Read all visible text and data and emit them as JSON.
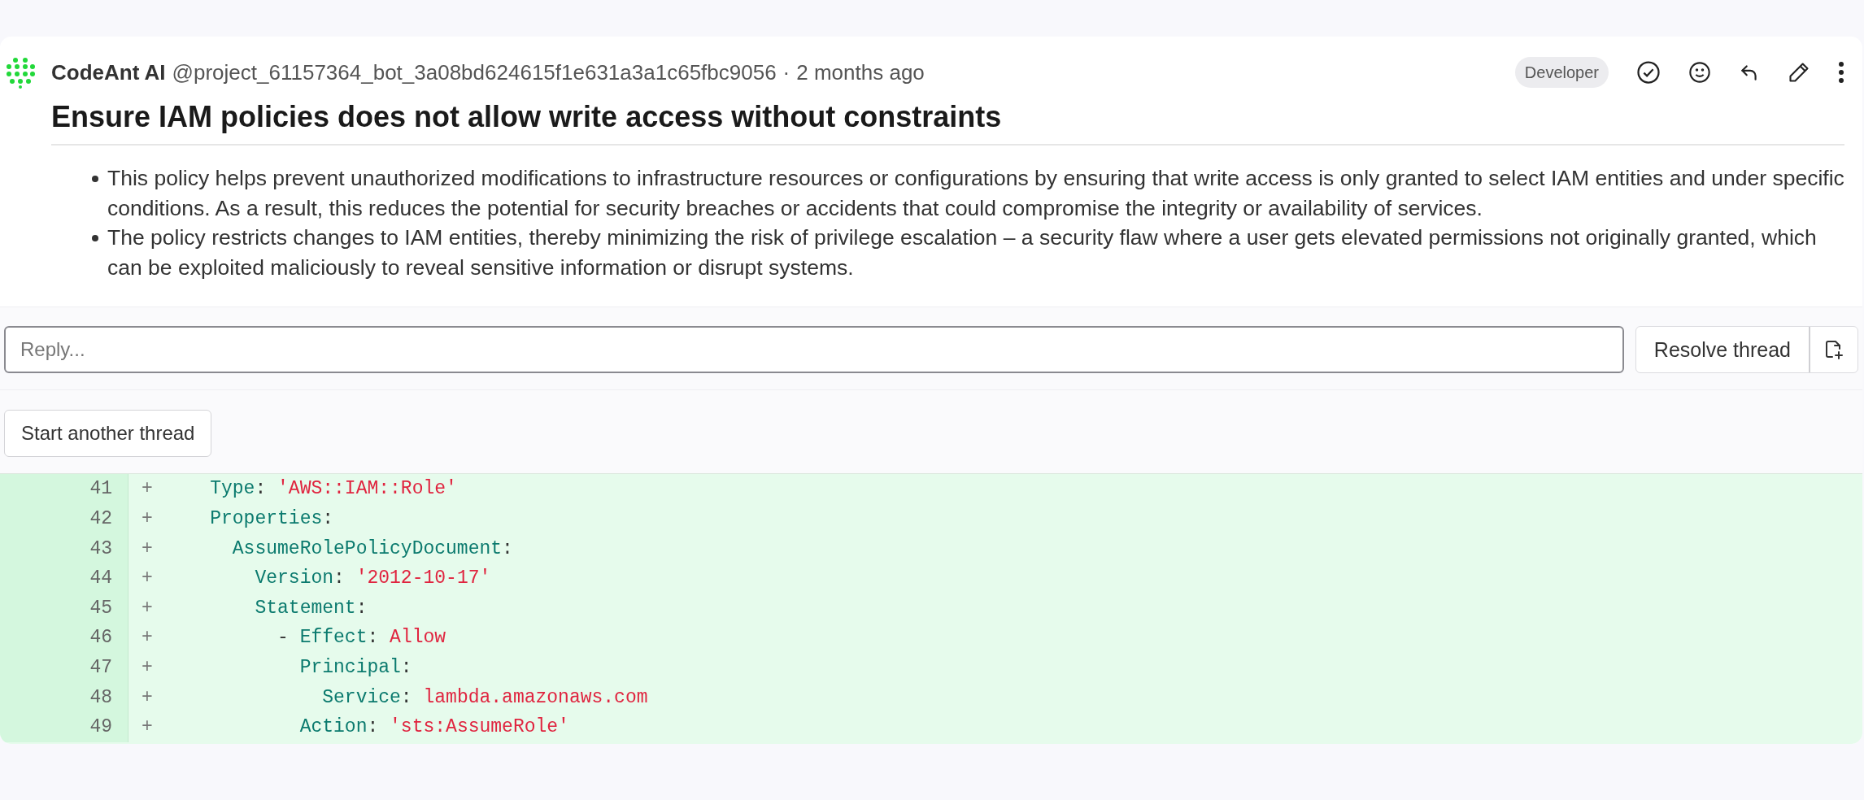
{
  "comment": {
    "author": "CodeAnt AI",
    "handle": "@project_61157364_bot_3a08bd624615f1e631a3a1c65fbc9056",
    "separator": "·",
    "time": "2 months ago",
    "role": "Developer",
    "title": "Ensure IAM policies does not allow write access without constraints",
    "bullets": [
      "This policy helps prevent unauthorized modifications to infrastructure resources or configurations by ensuring that write access is only granted to select IAM entities and under specific conditions. As a result, this reduces the potential for security breaches or accidents that could compromise the integrity or availability of services.",
      "The policy restricts changes to IAM entities, thereby minimizing the risk of privilege escalation – a security flaw where a user gets elevated permissions not originally granted, which can be exploited maliciously to reveal sensitive information or disrupt systems."
    ]
  },
  "reply": {
    "placeholder": "Reply...",
    "resolve_button": "Resolve thread"
  },
  "start_thread_button": "Start another thread",
  "diff": [
    {
      "number": "41",
      "sign": "+",
      "tokens": [
        {
          "kind": "key",
          "text": "    Type"
        },
        {
          "kind": "punct",
          "text": ": "
        },
        {
          "kind": "string",
          "text": "'AWS::IAM::Role'"
        }
      ]
    },
    {
      "number": "42",
      "sign": "+",
      "tokens": [
        {
          "kind": "key",
          "text": "    Properties"
        },
        {
          "kind": "punct",
          "text": ":"
        }
      ]
    },
    {
      "number": "43",
      "sign": "+",
      "tokens": [
        {
          "kind": "key",
          "text": "      AssumeRolePolicyDocument"
        },
        {
          "kind": "punct",
          "text": ":"
        }
      ]
    },
    {
      "number": "44",
      "sign": "+",
      "tokens": [
        {
          "kind": "key",
          "text": "        Version"
        },
        {
          "kind": "punct",
          "text": ": "
        },
        {
          "kind": "string",
          "text": "'2012-10-17'"
        }
      ]
    },
    {
      "number": "45",
      "sign": "+",
      "tokens": [
        {
          "kind": "key",
          "text": "        Statement"
        },
        {
          "kind": "punct",
          "text": ":"
        }
      ]
    },
    {
      "number": "46",
      "sign": "+",
      "tokens": [
        {
          "kind": "punct",
          "text": "          - "
        },
        {
          "kind": "key",
          "text": "Effect"
        },
        {
          "kind": "punct",
          "text": ": "
        },
        {
          "kind": "string",
          "text": "Allow"
        }
      ]
    },
    {
      "number": "47",
      "sign": "+",
      "tokens": [
        {
          "kind": "key",
          "text": "            Principal"
        },
        {
          "kind": "punct",
          "text": ":"
        }
      ]
    },
    {
      "number": "48",
      "sign": "+",
      "tokens": [
        {
          "kind": "key",
          "text": "              Service"
        },
        {
          "kind": "punct",
          "text": ": "
        },
        {
          "kind": "string",
          "text": "lambda.amazonaws.com"
        }
      ]
    },
    {
      "number": "49",
      "sign": "+",
      "tokens": [
        {
          "kind": "key",
          "text": "            Action"
        },
        {
          "kind": "punct",
          "text": ": "
        },
        {
          "kind": "string",
          "text": "'sts:AssumeRole'"
        }
      ]
    }
  ]
}
